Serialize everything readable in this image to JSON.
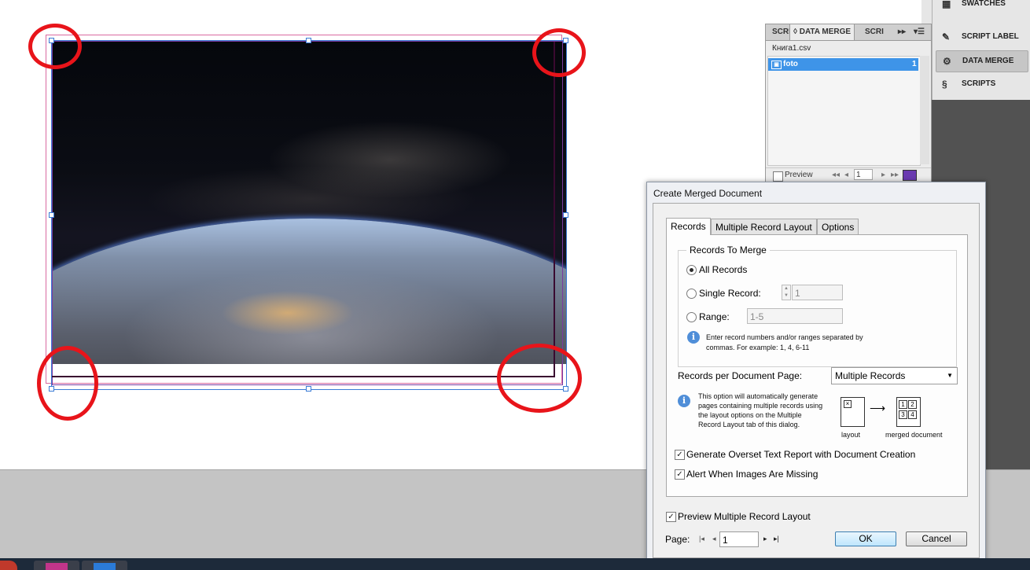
{
  "panel": {
    "tab_script_left": "SCRI",
    "tab_data_merge": "DATA MERGE",
    "tab_script_right": "SCRI",
    "arrows": "▸▸",
    "menu": "▾☰",
    "file_name": "Книга1.csv",
    "field_name": "foto",
    "field_count": "1",
    "preview_label": "Preview",
    "record_value": "1"
  },
  "dock": {
    "items": [
      {
        "label": "SWATCHES",
        "icon": "swatches-icon"
      },
      {
        "label": "SCRIPT LABEL",
        "icon": "script-label-icon"
      },
      {
        "label": "DATA MERGE",
        "icon": "data-merge-icon"
      },
      {
        "label": "SCRIPTS",
        "icon": "scripts-icon"
      }
    ]
  },
  "dialog": {
    "title": "Create Merged Document",
    "tabs": [
      "Records",
      "Multiple Record Layout",
      "Options"
    ],
    "group_title": "Records To Merge",
    "radio_all": "All Records",
    "radio_single": "Single Record:",
    "single_value": "1",
    "radio_range": "Range:",
    "range_value": "1-5",
    "range_hint_1": "Enter record numbers and/or ranges separated by",
    "range_hint_2": "commas. For example: 1, 4, 6-11",
    "per_page_label": "Records per Document Page:",
    "per_page_value": "Multiple Records",
    "info_1": "This option will automatically generate",
    "info_2": "pages containing multiple records using",
    "info_3": "the layout options on the Multiple",
    "info_4": "Record Layout tab of this dialog.",
    "diagram_layout": "layout",
    "diagram_merged": "merged document",
    "diagram_cells": [
      "1",
      "2",
      "3",
      "4"
    ],
    "check_overset": "Generate Overset Text Report with Document Creation",
    "check_images": "Alert When Images Are Missing",
    "check_preview": "Preview Multiple Record Layout",
    "page_label": "Page:",
    "page_value": "1",
    "ok_label": "OK",
    "cancel_label": "Cancel"
  },
  "colors": {
    "annotation": "#e8141a",
    "selection": "#3a7bd5",
    "panel_highlight": "#3e94e8"
  }
}
